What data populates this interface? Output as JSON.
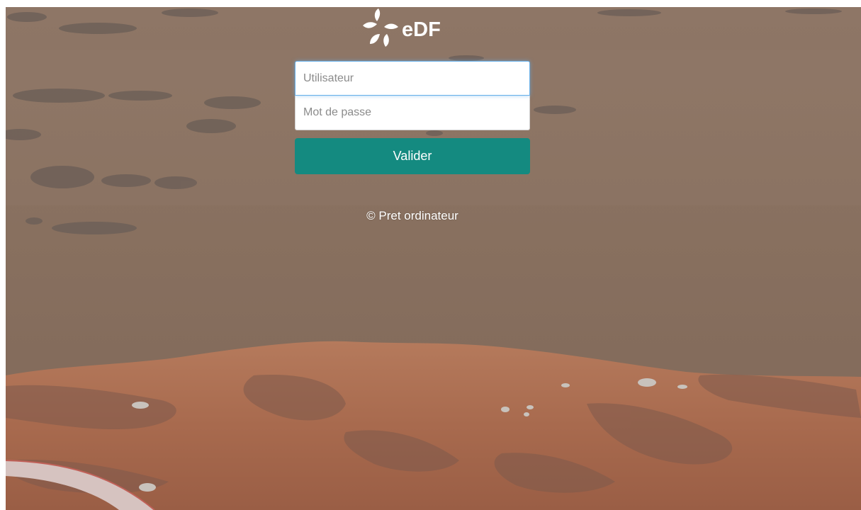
{
  "brand": {
    "logo_text": "eDF",
    "logo_color": "#ffffff"
  },
  "login": {
    "username_placeholder": "Utilisateur",
    "password_placeholder": "Mot de passe",
    "submit_label": "Valider",
    "accent_color": "#148a80"
  },
  "footer": {
    "credit": "© Pret ordinateur"
  },
  "background": {
    "description_icon": "volcanic-landscape-photo"
  }
}
